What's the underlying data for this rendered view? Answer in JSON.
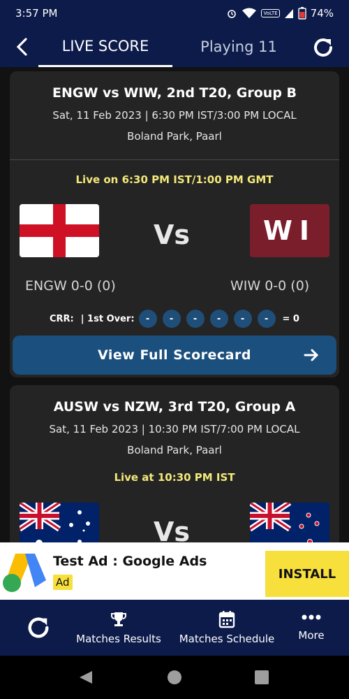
{
  "status_bar": {
    "time": "3:57 PM",
    "battery": "74%",
    "network_label": "VoLTE"
  },
  "header": {
    "tabs": [
      {
        "label": "LIVE SCORE",
        "active": true
      },
      {
        "label": "Playing 11",
        "active": false
      }
    ]
  },
  "matches": [
    {
      "title": "ENGW vs WIW, 2nd T20, Group B",
      "datetime": "Sat, 11 Feb 2023 | 6:30 PM IST/3:00 PM LOCAL",
      "venue": "Boland Park, Paarl",
      "live_text": "Live on 6:30 PM IST/1:00 PM GMT",
      "vs": "Vs",
      "team1_score": "ENGW 0-0 (0)",
      "team2_score": "WIW 0-0 (0)",
      "team2_flag_text": "WI",
      "crr_label": "CRR:",
      "over_label": "| 1st Over:",
      "balls": [
        "-",
        "-",
        "-",
        "-",
        "-",
        "-"
      ],
      "over_total": "= 0",
      "scorecard_button": "View Full Scorecard"
    },
    {
      "title": "AUSW vs NZW, 3rd T20, Group A",
      "datetime": "Sat, 11 Feb 2023 | 10:30 PM IST/7:00 PM LOCAL",
      "venue": "Boland Park, Paarl",
      "live_text": "Live at 10:30 PM IST",
      "vs": "Vs"
    }
  ],
  "ad": {
    "title": "Test Ad : Google Ads",
    "badge": "Ad",
    "install": "INSTALL"
  },
  "bottom_nav": [
    {
      "label": "",
      "icon": "refresh-icon"
    },
    {
      "label": "Matches Results",
      "icon": "trophy-icon"
    },
    {
      "label": "Matches Schedule",
      "icon": "calendar-icon"
    },
    {
      "label": "More",
      "icon": "more-dots-icon"
    }
  ],
  "colors": {
    "header": "#0d1b4a",
    "card": "#242424",
    "live_text": "#f3e97a",
    "button": "#1b4f7d",
    "ad_yellow": "#f8e03c"
  }
}
